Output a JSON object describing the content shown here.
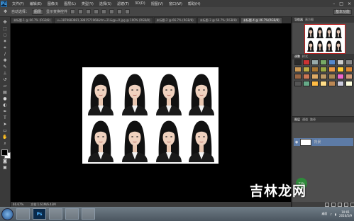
{
  "menubar": {
    "logo": "Ps",
    "items": [
      "文件(F)",
      "编辑(E)",
      "图像(I)",
      "图层(L)",
      "类型(Y)",
      "选择(S)",
      "滤镜(T)",
      "3D(D)",
      "视图(V)",
      "窗口(W)",
      "帮助(H)"
    ],
    "controls": [
      "–",
      "□",
      "×"
    ]
  },
  "options": {
    "auto_select": "自动选择：",
    "layer_select": "图层",
    "show_transform": "显示变换控件",
    "workspace": "基本功能"
  },
  "tabs": [
    {
      "label": "未标题-1 @ 66.7% (RGB/8)"
    },
    {
      "label": "u=3879883881,3881571968&fm=21&gp=0.jpg @ 100% (RGB/8)"
    },
    {
      "label": "未标题-2 @ 66.7% (RGB/8)"
    },
    {
      "label": "未标题-3 @ 66.7% (RGB/8)"
    },
    {
      "label": "未标题-4 @ 46.7%(RGB/8)",
      "active": true
    }
  ],
  "status": {
    "zoom": "46.67%",
    "doc_size": "文档:1.61M/6.43M"
  },
  "panels": {
    "top_tabs": [
      "导航器",
      "直方图"
    ],
    "mid_tabs": [
      "调整",
      "样式"
    ],
    "layers_tabs": [
      "图层",
      "通道",
      "路径"
    ],
    "layer_name": "背景",
    "percent": "73%"
  },
  "taskbar": {
    "apps": [
      "",
      "Ps",
      "",
      "",
      ""
    ],
    "clock_time": "10:01",
    "clock_date": "2016/5/9",
    "tray_text": "桌面"
  },
  "watermark": "吉林龙网"
}
